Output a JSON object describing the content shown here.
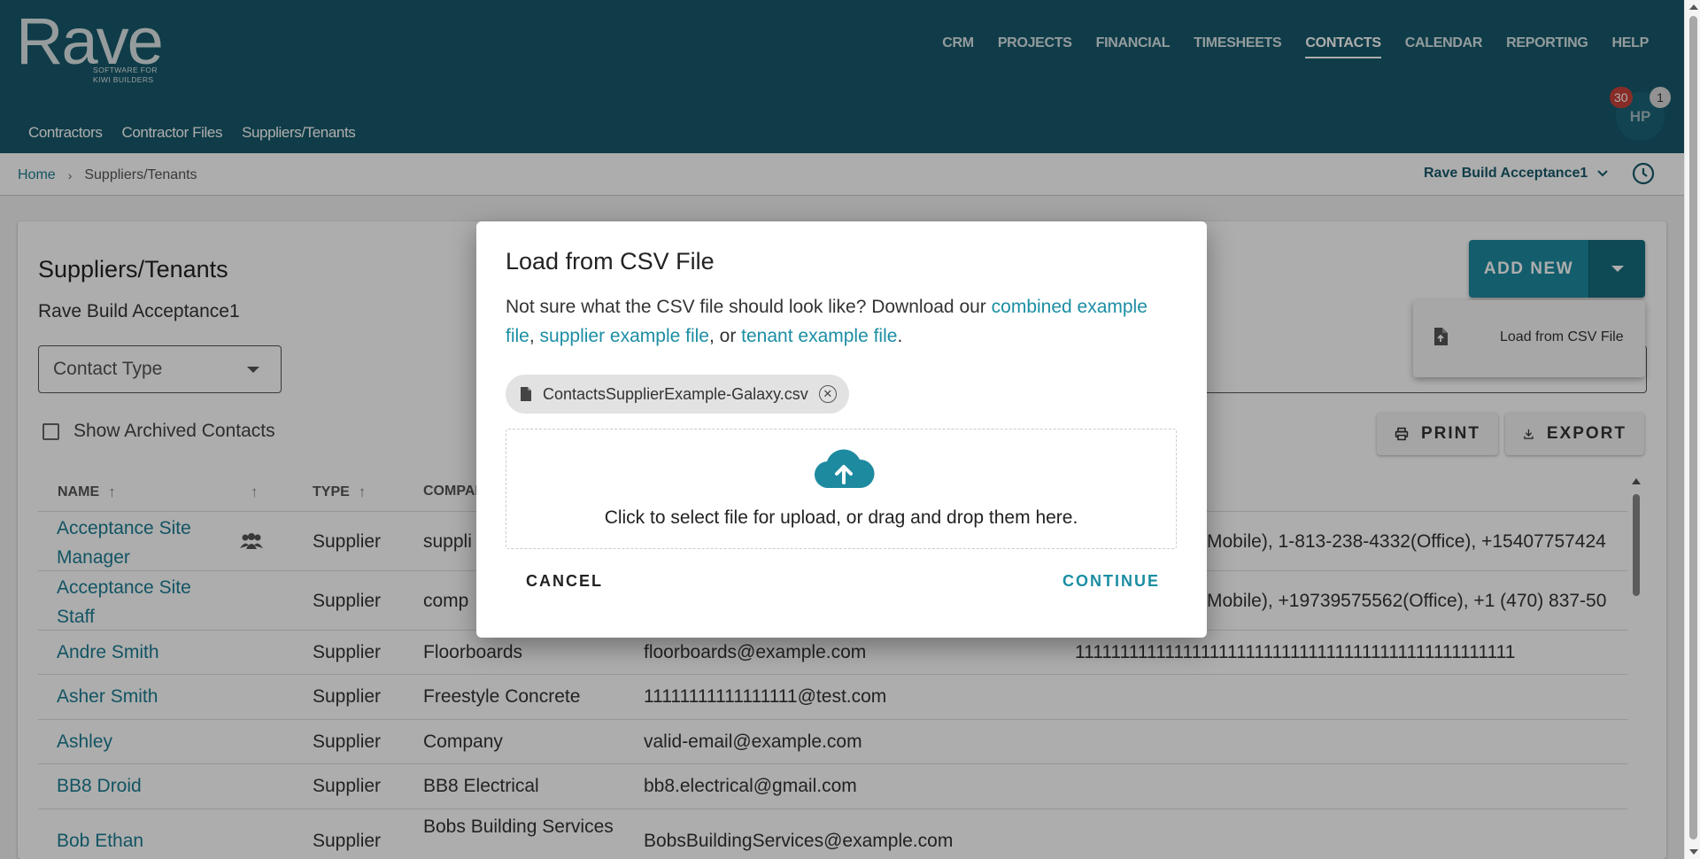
{
  "brand": {
    "name": "Rave",
    "tagline": "SOFTWARE FOR\nKIWI BUILDERS"
  },
  "main_nav": [
    {
      "label": "CRM",
      "active": false
    },
    {
      "label": "PROJECTS",
      "active": false
    },
    {
      "label": "FINANCIAL",
      "active": false
    },
    {
      "label": "TIMESHEETS",
      "active": false
    },
    {
      "label": "CONTACTS",
      "active": true
    },
    {
      "label": "CALENDAR",
      "active": false
    },
    {
      "label": "REPORTING",
      "active": false
    },
    {
      "label": "HELP",
      "active": false
    }
  ],
  "sub_nav": [
    "Contractors",
    "Contractor Files",
    "Suppliers/Tenants"
  ],
  "user": {
    "initials": "HP",
    "notifications": "30",
    "messages": "1"
  },
  "breadcrumb": {
    "home": "Home",
    "separator": "›",
    "current": "Suppliers/Tenants"
  },
  "company_selector": "Rave Build Acceptance1",
  "page": {
    "title": "Suppliers/Tenants",
    "subtitle": "Rave Build Acceptance1",
    "contact_type_placeholder": "Contact Type",
    "show_archived_label": "Show Archived Contacts",
    "add_new_label": "ADD NEW",
    "menu_item_label": "Load from CSV File",
    "print_label": "PRINT",
    "export_label": "EXPORT"
  },
  "table": {
    "headers": {
      "name": "NAME",
      "type": "TYPE",
      "company": "COMPANY"
    },
    "rows": [
      {
        "name": "Acceptance Site Manager",
        "type": "Supplier",
        "company": "suppli",
        "email": "",
        "phone": "Mobile), 1-813-238-4332(Office), +15407757424",
        "group": true
      },
      {
        "name": "Acceptance Site Staff",
        "type": "Supplier",
        "company": "comp",
        "email": "",
        "phone": "Mobile), +19739575562(Office), +1 (470) 837-50",
        "group": false
      },
      {
        "name": "Andre Smith",
        "type": "Supplier",
        "company": "Floorboards",
        "email": "floorboards@example.com",
        "phone": "1111111111111111111111111111111111111111111111111",
        "group": false
      },
      {
        "name": "Asher Smith",
        "type": "Supplier",
        "company": "Freestyle Concrete",
        "email": "11111111111111111@test.com",
        "phone": "",
        "group": false
      },
      {
        "name": "Ashley",
        "type": "Supplier",
        "company": "Company",
        "email": "valid-email@example.com",
        "phone": "",
        "group": false
      },
      {
        "name": "BB8 Droid",
        "type": "Supplier",
        "company": "BB8 Electrical",
        "email": "bb8.electrical@gmail.com",
        "phone": "",
        "group": false
      },
      {
        "name": "Bob Ethan",
        "type": "Supplier",
        "company": "Bobs Building Services",
        "email": "BobsBuildingServices@example.com",
        "phone": "",
        "group": false
      }
    ]
  },
  "dialog": {
    "title": "Load from CSV File",
    "intro": "Not sure what the CSV file should look like? Download our",
    "link_combined": "combined example file",
    "sep1": ",",
    "link_supplier": "supplier example file",
    "sep2": ", or",
    "link_tenant": "tenant example file",
    "end": ".",
    "file_name": "ContactsSupplierExample-Galaxy.csv",
    "dropzone_text": "Click to select file for upload, or drag and drop them here.",
    "cancel_label": "CANCEL",
    "continue_label": "CONTINUE"
  },
  "colors": {
    "header": "#17596a",
    "accent": "#1b8ea3",
    "badge_red": "#c9413a"
  }
}
